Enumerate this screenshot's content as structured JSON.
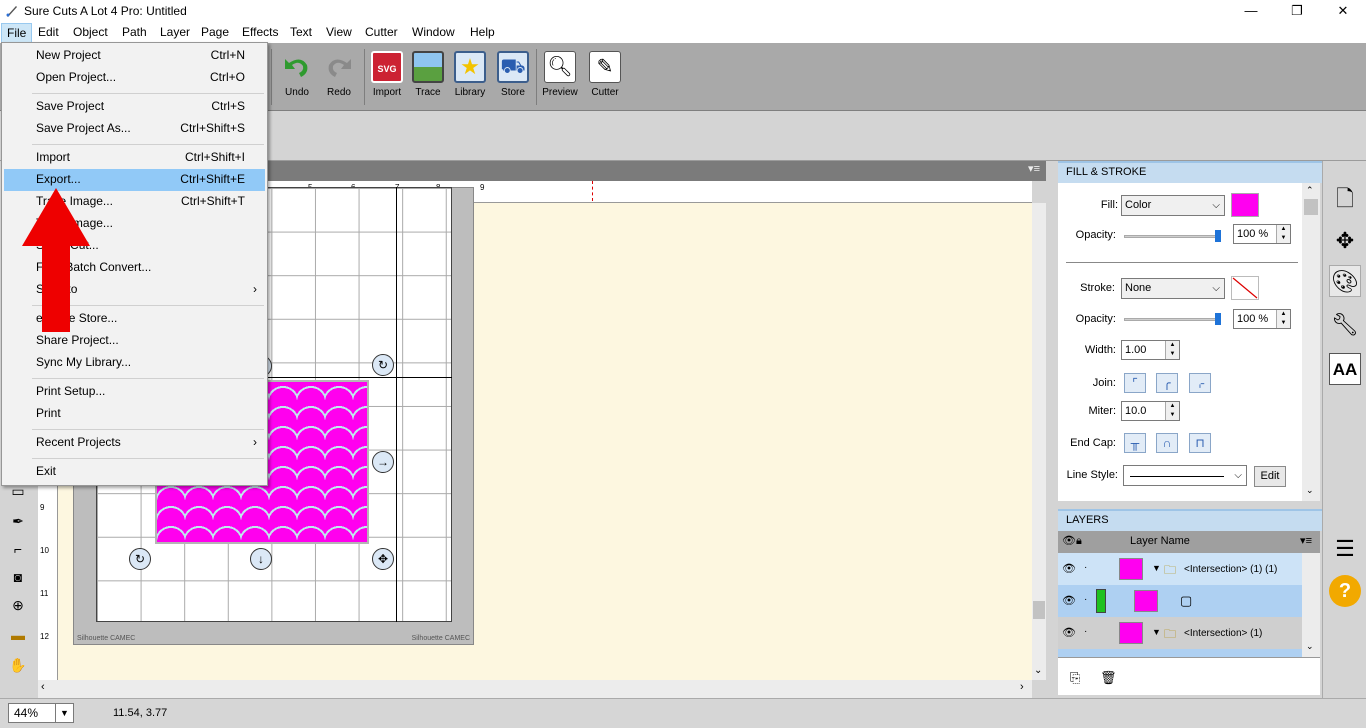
{
  "window": {
    "title": "Sure Cuts A Lot 4 Pro: Untitled",
    "minimize": "—",
    "restore": "❐",
    "close": "✕"
  },
  "menubar": [
    "File",
    "Edit",
    "Object",
    "Path",
    "Layer",
    "Page",
    "Effects",
    "Text",
    "View",
    "Cutter",
    "Window",
    "Help"
  ],
  "toolbar": {
    "undo": "Undo",
    "redo": "Redo",
    "import": "Import",
    "trace": "Trace",
    "library": "Library",
    "store": "Store",
    "preview": "Preview",
    "cutter": "Cutter",
    "import_icon_text": "SVG"
  },
  "file_menu": {
    "items": [
      {
        "label": "New Project",
        "shortcut": "Ctrl+N"
      },
      {
        "label": "Open Project...",
        "shortcut": "Ctrl+O"
      },
      {
        "label": "Save Project",
        "shortcut": "Ctrl+S"
      },
      {
        "label": "Save Project As...",
        "shortcut": "Ctrl+Shift+S"
      },
      {
        "label": "Import",
        "shortcut": "Ctrl+Shift+I"
      },
      {
        "label": "Export...",
        "shortcut": "Ctrl+Shift+E"
      },
      {
        "label": "Trace Image...",
        "shortcut": "Ctrl+Shift+T"
      },
      {
        "label": "Trace Image...",
        "shortcut": ""
      },
      {
        "label": "Scan2Cut...",
        "shortcut": ""
      },
      {
        "label": "FCM Batch Convert...",
        "shortcut": ""
      },
      {
        "label": "Send to",
        "shortcut": "›"
      },
      {
        "label": "eshape Store...",
        "shortcut": ""
      },
      {
        "label": "Share Project...",
        "shortcut": ""
      },
      {
        "label": "Sync My Library...",
        "shortcut": ""
      },
      {
        "label": "Print Setup...",
        "shortcut": ""
      },
      {
        "label": "Print",
        "shortcut": ""
      },
      {
        "label": "Recent Projects",
        "shortcut": "›"
      },
      {
        "label": "Exit",
        "shortcut": ""
      }
    ],
    "highlighted_index": 5
  },
  "ruler": {
    "top_ticks": [
      "5",
      "6",
      "7",
      "8",
      "9"
    ],
    "left_ticks": [
      "9",
      "10",
      "11",
      "12"
    ]
  },
  "mat": {
    "brand_left": "Silhouette CAMEC",
    "brand_right": "Silhouette CAMEC"
  },
  "status": {
    "zoom": "44%",
    "coords": "11.54, 3.77"
  },
  "fill_stroke": {
    "header": "FILL & STROKE",
    "fill_label": "Fill:",
    "fill_value": "Color",
    "fill_color": "#ff00f0",
    "opacity_label": "Opacity:",
    "fill_opacity": "100 %",
    "stroke_label": "Stroke:",
    "stroke_value": "None",
    "stroke_opacity": "100 %",
    "width_label": "Width:",
    "width_value": "1.00",
    "join_label": "Join:",
    "miter_label": "Miter:",
    "miter_value": "10.0",
    "endcap_label": "End Cap:",
    "linestyle_label": "Line Style:",
    "edit_button": "Edit"
  },
  "layers": {
    "header": "LAYERS",
    "column": "Layer Name",
    "rows": [
      {
        "name": "<Intersection> (1) (1)"
      },
      {
        "name": ""
      },
      {
        "name": "<Intersection> (1)"
      }
    ]
  },
  "accent": "#9ec4e6"
}
